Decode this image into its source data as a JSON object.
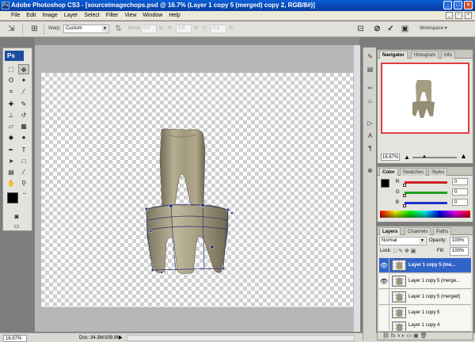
{
  "window": {
    "title": "Adobe Photoshop CS3 - [sourceimagechops.psd @ 16.7% (Layer 1 copy 5 (merged) copy 2, RGB/8#)]"
  },
  "menu": [
    "File",
    "Edit",
    "Image",
    "Layer",
    "Select",
    "Filter",
    "View",
    "Window",
    "Help"
  ],
  "options": {
    "warp_label": "Warp:",
    "warp_value": "Custom",
    "bend_label": "Bend:",
    "bend_value": "0.0",
    "h_label": "H:",
    "h_value": "0.0",
    "v_label": "V:",
    "v_value": "0.0",
    "workspace_label": "Workspace ▾",
    "pct": "%"
  },
  "toolbox": {
    "logo": "Ps"
  },
  "status": {
    "zoom": "16.67%",
    "doc": "Doc: 34.3M/109.9M"
  },
  "navigator": {
    "tabs": [
      "Navigator",
      "Histogram",
      "Info"
    ],
    "zoom": "16.67%"
  },
  "color": {
    "tabs": [
      "Color",
      "Swatches",
      "Styles"
    ],
    "channels": [
      {
        "label": "R",
        "value": "0",
        "color": "#d02020"
      },
      {
        "label": "G",
        "value": "0",
        "color": "#20a020"
      },
      {
        "label": "B",
        "value": "0",
        "color": "#2030d0"
      }
    ]
  },
  "layers": {
    "tabs": [
      "Layers",
      "Channels",
      "Paths"
    ],
    "blend_mode": "Normal",
    "opacity_label": "Opacity:",
    "opacity_value": "100%",
    "lock_label": "Lock:",
    "fill_label": "Fill:",
    "fill_value": "100%",
    "items": [
      {
        "name": "Layer 1 copy 5 (me...",
        "visible": true,
        "selected": true
      },
      {
        "name": "Layer 1 copy 5 (merge...",
        "visible": true,
        "selected": false
      },
      {
        "name": "Layer 1 copy 5 (merged)",
        "visible": false,
        "selected": false
      },
      {
        "name": "Layer 1 copy 5",
        "visible": false,
        "selected": false
      },
      {
        "name": "Layer 1 copy 4",
        "visible": false,
        "selected": false
      }
    ]
  },
  "colors": {
    "accent": "#3164c8",
    "titlebar": "#0a5fd8",
    "nav_frame": "#e04040"
  }
}
